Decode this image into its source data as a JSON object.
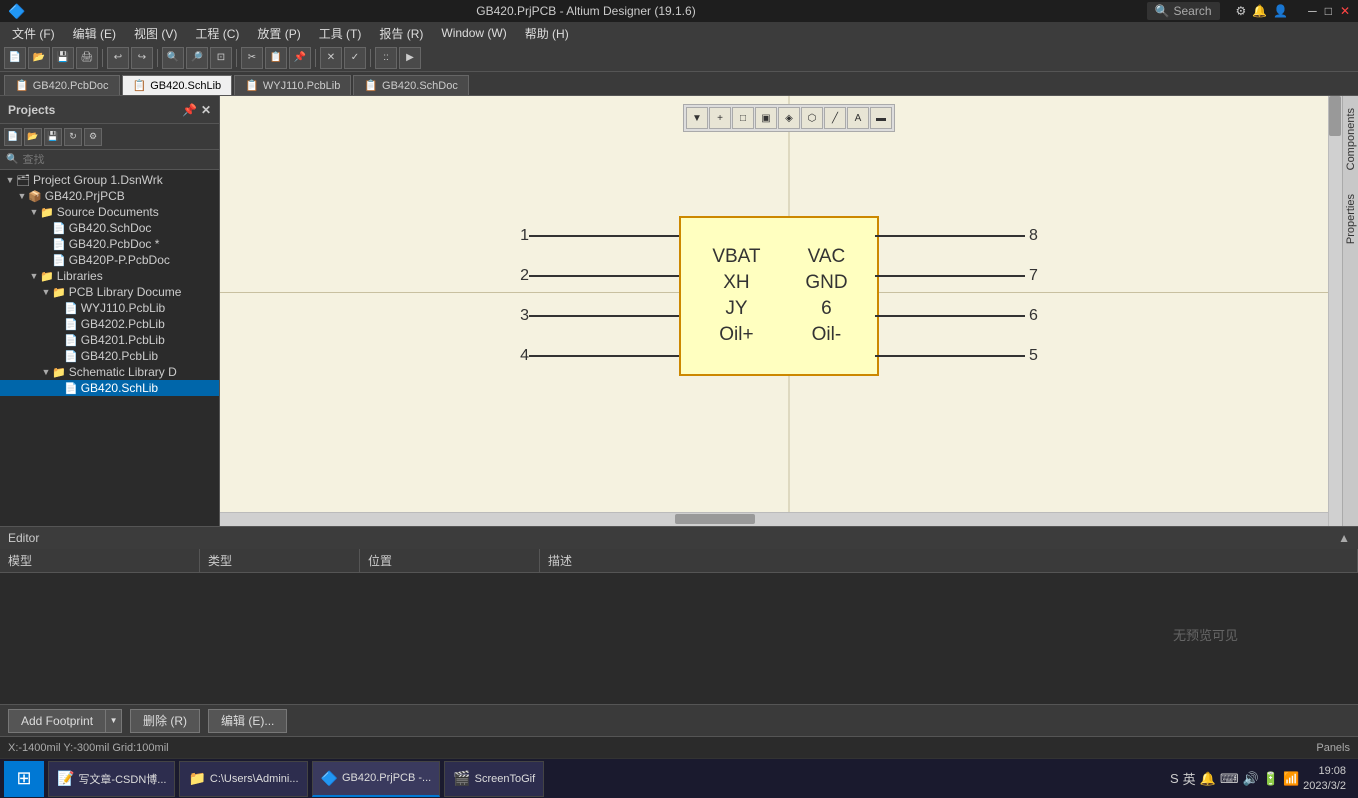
{
  "titlebar": {
    "title": "GB420.PrjPCB - Altium Designer (19.1.6)",
    "search_label": "Search",
    "min_label": "─",
    "max_label": "□",
    "close_label": "✕"
  },
  "menubar": {
    "items": [
      {
        "id": "file",
        "label": "文件 (F)"
      },
      {
        "id": "edit",
        "label": "编辑 (E)"
      },
      {
        "id": "view",
        "label": "视图 (V)"
      },
      {
        "id": "project",
        "label": "工程 (C)"
      },
      {
        "id": "place",
        "label": "放置 (P)"
      },
      {
        "id": "tools",
        "label": "工具 (T)"
      },
      {
        "id": "reports",
        "label": "报告 (R)"
      },
      {
        "id": "window",
        "label": "Window (W)"
      },
      {
        "id": "help",
        "label": "帮助 (H)"
      }
    ]
  },
  "tabs": [
    {
      "id": "pcbdoc",
      "label": "GB420.PcbDoc",
      "active": false,
      "icon": "📋"
    },
    {
      "id": "schlib",
      "label": "GB420.SchLib",
      "active": true,
      "icon": "📋"
    },
    {
      "id": "wyj110",
      "label": "WYJ110.PcbLib",
      "active": false,
      "icon": "📋"
    },
    {
      "id": "schdoc",
      "label": "GB420.SchDoc",
      "active": false,
      "icon": "📋"
    }
  ],
  "projects_panel": {
    "title": "Projects",
    "search_placeholder": "查找",
    "tree": [
      {
        "id": "group1",
        "label": "Project Group 1.DsnWrk",
        "level": 0,
        "icon": "🗂",
        "expanded": true,
        "type": "group"
      },
      {
        "id": "gb420prj",
        "label": "GB420.PrjPCB",
        "level": 1,
        "icon": "📦",
        "expanded": true,
        "type": "project"
      },
      {
        "id": "source_docs",
        "label": "Source Documents",
        "level": 2,
        "icon": "📁",
        "expanded": true,
        "type": "folder"
      },
      {
        "id": "schdoc",
        "label": "GB420.SchDoc",
        "level": 3,
        "icon": "📄",
        "type": "file"
      },
      {
        "id": "pcbdoc_mod",
        "label": "GB420.PcbDoc *",
        "level": 3,
        "icon": "📄",
        "type": "file"
      },
      {
        "id": "pcbdoc_p",
        "label": "GB420P-P.PcbDoc",
        "level": 3,
        "icon": "📄",
        "type": "file"
      },
      {
        "id": "libraries",
        "label": "Libraries",
        "level": 2,
        "icon": "📁",
        "expanded": true,
        "type": "folder"
      },
      {
        "id": "pcblib_docs",
        "label": "PCB Library Docume",
        "level": 3,
        "icon": "📁",
        "expanded": true,
        "type": "folder"
      },
      {
        "id": "wyj110",
        "label": "WYJ110.PcbLib",
        "level": 4,
        "icon": "📄",
        "type": "file"
      },
      {
        "id": "gb4202",
        "label": "GB4202.PcbLib",
        "level": 4,
        "icon": "📄",
        "type": "file"
      },
      {
        "id": "gb4201",
        "label": "GB4201.PcbLib",
        "level": 4,
        "icon": "📄",
        "type": "file"
      },
      {
        "id": "gb420pcb",
        "label": "GB420.PcbLib",
        "level": 4,
        "icon": "📄",
        "type": "file"
      },
      {
        "id": "schlib_docs",
        "label": "Schematic Library D",
        "level": 3,
        "icon": "📁",
        "expanded": true,
        "type": "folder"
      },
      {
        "id": "gb420schlib",
        "label": "GB420.SchLib",
        "level": 4,
        "icon": "📄",
        "type": "file",
        "selected": true
      }
    ]
  },
  "canvas_toolbar": {
    "tools": [
      "▼",
      "+",
      "⬚",
      "⬚",
      "◈",
      "⬡",
      "✎",
      "A",
      "▬"
    ]
  },
  "schematic": {
    "component": {
      "pins_left": [
        {
          "num": "1",
          "label": "VBAT"
        },
        {
          "num": "2",
          "label": "XH"
        },
        {
          "num": "3",
          "label": "JY"
        },
        {
          "num": "4",
          "label": "Oil+"
        }
      ],
      "pins_right": [
        {
          "num": "8",
          "label": "VAC"
        },
        {
          "num": "7",
          "label": "GND"
        },
        {
          "num": "6",
          "label": "6"
        },
        {
          "num": "5",
          "label": "Oil-"
        }
      ]
    }
  },
  "editor": {
    "title": "Editor",
    "columns": [
      {
        "id": "model",
        "label": "模型"
      },
      {
        "id": "type",
        "label": "类型"
      },
      {
        "id": "position",
        "label": "位置"
      },
      {
        "id": "description",
        "label": "描述"
      }
    ],
    "no_preview": "无预览可见"
  },
  "bottom_toolbar": {
    "add_footprint": "Add Footprint",
    "delete": "删除 (R)",
    "edit": "编辑 (E)..."
  },
  "statusbar": {
    "coordinates": "X:-1400mil  Y:-300mil    Grid:100mil",
    "panels": "Panels"
  },
  "taskbar": {
    "items": [
      {
        "id": "csdn",
        "label": "写文章-CSDN博...",
        "icon": "📝"
      },
      {
        "id": "explorer",
        "label": "C:\\Users\\Admini...",
        "icon": "📁"
      },
      {
        "id": "altium",
        "label": "GB420.PrjPCB -...",
        "icon": "🔷",
        "active": true
      },
      {
        "id": "screentogif",
        "label": "ScreenToGif",
        "icon": "🎬"
      }
    ],
    "time": "19:08",
    "date": "2023/3/2"
  },
  "side_tab": {
    "components": "Components",
    "properties": "Properties"
  }
}
